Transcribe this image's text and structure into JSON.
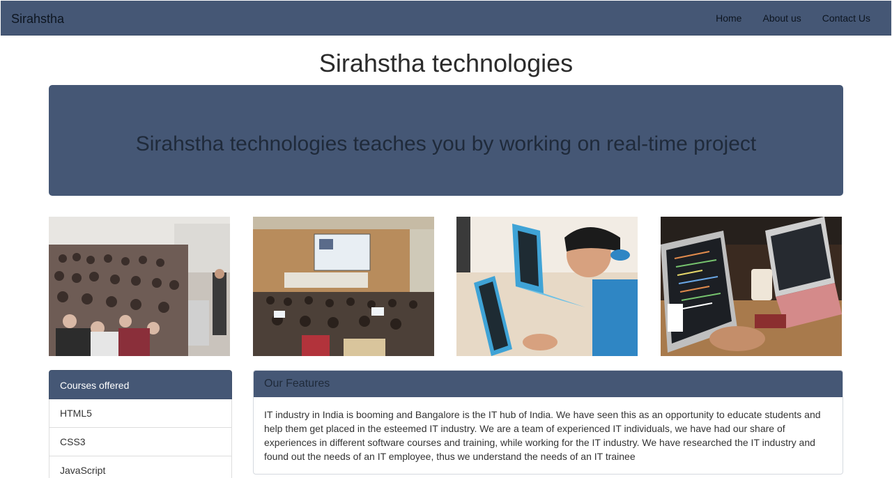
{
  "navbar": {
    "brand": "Sirahstha",
    "links": [
      "Home",
      "About us",
      "Contact Us"
    ]
  },
  "page_title": "Sirahstha technologies",
  "jumbotron": {
    "text": "Sirahstha technologies teaches you by working on real-time project"
  },
  "photos": [
    {
      "icon": "crowded-auditorium-photo"
    },
    {
      "icon": "lecture-hall-projector-photo"
    },
    {
      "icon": "child-with-laptop-photo"
    },
    {
      "icon": "laptops-coding-photo"
    }
  ],
  "courses": {
    "header": "Courses offered",
    "items": [
      "HTML5",
      "CSS3",
      "JavaScript"
    ]
  },
  "features": {
    "title": "Our Features",
    "body": "IT industry in India is booming and Bangalore is the IT hub of India. We have seen this as an opportunity to educate students and help them get placed in the esteemed IT industry. We are a team of experienced IT individuals, we have had our share of experiences in different software courses and training, while working for the IT industry. We have researched the IT industry and found out the needs of an IT employee, thus we understand the needs of an IT trainee"
  },
  "colors": {
    "primary": "#455775",
    "text_dark": "#1f2a3a"
  }
}
